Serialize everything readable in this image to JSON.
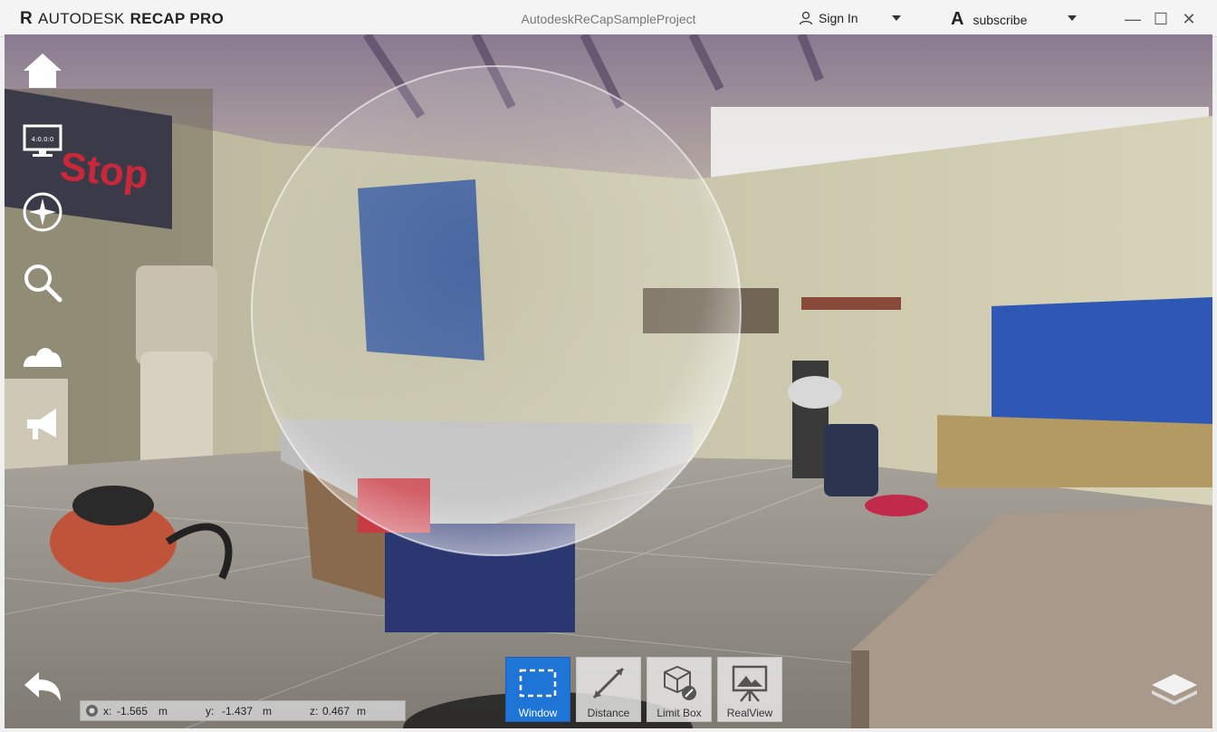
{
  "app": {
    "brand_logo": "R",
    "brand_name": "AUTODESK",
    "brand_product": "RECAP PRO",
    "project_title": "AutodeskReCapSampleProject"
  },
  "account": {
    "signin_label": "Sign In",
    "subscribe_label": "subscribe",
    "subscribe_logo": "A"
  },
  "window_controls": {
    "minimize": "—",
    "maximize": "☐",
    "close": "✕"
  },
  "left_nav": {
    "items": [
      {
        "name": "home-icon"
      },
      {
        "name": "display-icon",
        "label": "4:0.0:0"
      },
      {
        "name": "compass-icon"
      },
      {
        "name": "search-icon"
      },
      {
        "name": "cloud-icon"
      },
      {
        "name": "announcement-icon"
      }
    ]
  },
  "tools": [
    {
      "label": "Window",
      "active": true
    },
    {
      "label": "Distance",
      "active": false
    },
    {
      "label": "Limit Box",
      "active": false
    },
    {
      "label": "RealView",
      "active": false
    }
  ],
  "coords": {
    "x_label": "x:",
    "x_value": "-1.565",
    "x_unit": "m",
    "y_label": "y:",
    "y_value": "-1.437",
    "y_unit": "m",
    "z_label": "z:",
    "z_value": "0.467",
    "z_unit": "m"
  },
  "colors": {
    "accent": "#1f75d6",
    "titlebar": "#f4f4f4"
  }
}
